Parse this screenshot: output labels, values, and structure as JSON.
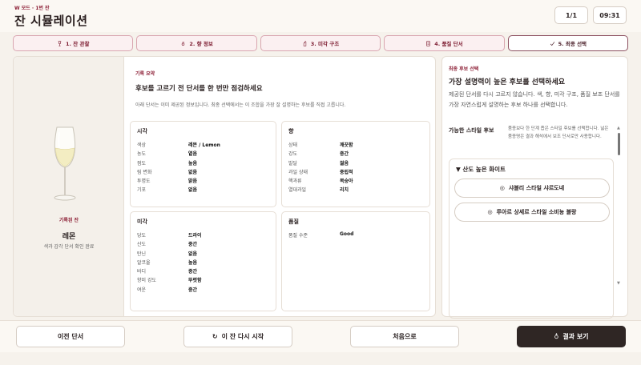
{
  "header": {
    "mode": "W 모드 · 1번 잔",
    "title": "잔 시뮬레이션",
    "page": "1/1",
    "time": "09:31"
  },
  "steps": [
    {
      "label": "1. 잔 관찰",
      "icon": "wine-glass-icon"
    },
    {
      "label": "2. 향 정보",
      "icon": "aroma-icon"
    },
    {
      "label": "3. 미각 구조",
      "icon": "taste-icon"
    },
    {
      "label": "4. 품질 단서",
      "icon": "quality-icon"
    },
    {
      "label": "5. 최종 선택",
      "icon": "check-icon"
    }
  ],
  "wine": {
    "recorded_label": "기록된 잔",
    "name": "레몬",
    "note": "색과 감각 단서 확인 완료"
  },
  "summary": {
    "label": "기록 요약",
    "title": "후보를 고르기 전 단서를 한 번만 점검하세요",
    "desc": "아래 단서는 이미 제공된 정보입니다. 최종 선택에서는 이 조합을 가장 잘 설명하는 후보를 직접 고릅니다."
  },
  "cards": {
    "sight": {
      "title": "시각",
      "rows": [
        {
          "k": "색상",
          "v": "레몬 / Lemon"
        },
        {
          "k": "농도",
          "v": "옅음"
        },
        {
          "k": "점도",
          "v": "높음"
        },
        {
          "k": "림 변화",
          "v": "없음"
        },
        {
          "k": "투명도",
          "v": "맑음"
        },
        {
          "k": "기포",
          "v": "없음"
        }
      ]
    },
    "aroma": {
      "title": "향",
      "rows": [
        {
          "k": "상태",
          "v": "깨끗함"
        },
        {
          "k": "강도",
          "v": "중간"
        },
        {
          "k": "발달",
          "v": "젊음"
        },
        {
          "k": "과일 상태",
          "v": "중립적"
        },
        {
          "k": "핵과류",
          "v": "복숭아"
        },
        {
          "k": "열대과일",
          "v": "리치"
        }
      ]
    },
    "taste": {
      "title": "미각",
      "rows": [
        {
          "k": "당도",
          "v": "드라이"
        },
        {
          "k": "산도",
          "v": "중간"
        },
        {
          "k": "탄닌",
          "v": "없음"
        },
        {
          "k": "알코올",
          "v": "높음"
        },
        {
          "k": "바디",
          "v": "중간"
        },
        {
          "k": "향미 강도",
          "v": "뚜렷함"
        },
        {
          "k": "여운",
          "v": "중간"
        }
      ]
    },
    "quality": {
      "title": "품질",
      "rows": [
        {
          "k": "품질 수준",
          "v": "Good"
        }
      ]
    }
  },
  "side": {
    "label": "최종 후보 선택",
    "title": "가장 설명력이 높은 후보를 선택하세요",
    "desc": "제공된 단서를 다시 고르지 않습니다. 색, 향, 미각 구조, 품질 보조 단서를 가장 자연스럽게 설명하는 후보 하나를 선택합니다.",
    "styles_head": "가능한 스타일 후보",
    "styles_note": "품종보다 한 단계 좁은 스타일 후보를 선택합니다. 넓은 품종명은 결과 해석에서 보조 단서로만 사용합니다.",
    "group_title": "▼ 산도 높은 화이트",
    "options": [
      {
        "label": "샤블리 스타일 샤르도네"
      },
      {
        "label": "루아르 상세르 스타일 소비뇽 블랑"
      }
    ]
  },
  "footer": {
    "prev": "이전 단서",
    "restart": "이 잔 다시 시작",
    "home": "처음으로",
    "result": "결과 보기"
  },
  "colors": {
    "accent": "#8c1e35",
    "primary_button": "#2f2624",
    "wine_fill": "#f3edc2"
  }
}
